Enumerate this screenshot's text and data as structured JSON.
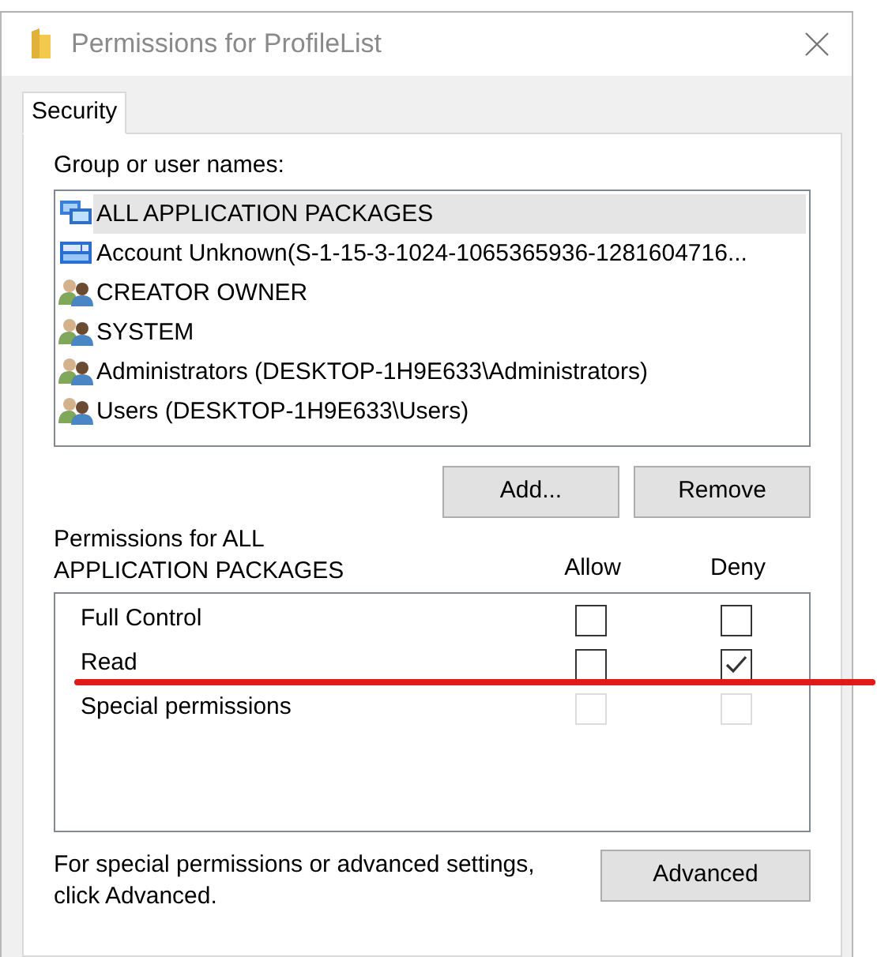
{
  "window": {
    "title": "Permissions for ProfileList"
  },
  "tabs": [
    {
      "label": "Security",
      "selected": true
    }
  ],
  "group_label": "Group or user names:",
  "principals": [
    {
      "name": "ALL APPLICATION PACKAGES",
      "kind": "package",
      "selected": true
    },
    {
      "name": "Account Unknown(S-1-15-3-1024-1065365936-1281604716...",
      "kind": "account",
      "selected": false
    },
    {
      "name": "CREATOR OWNER",
      "kind": "users",
      "selected": false
    },
    {
      "name": "SYSTEM",
      "kind": "users",
      "selected": false
    },
    {
      "name": "Administrators (DESKTOP-1H9E633\\Administrators)",
      "kind": "users",
      "selected": false
    },
    {
      "name": "Users (DESKTOP-1H9E633\\Users)",
      "kind": "users",
      "selected": false
    }
  ],
  "principal_buttons": [
    "Add...",
    "Remove"
  ],
  "permissions_label": "Permissions for ALL APPLICATION PACKAGES",
  "columns": [
    "Allow",
    "Deny"
  ],
  "permissions": [
    {
      "name": "Full Control",
      "allow": false,
      "deny": false,
      "disabled": false
    },
    {
      "name": "Read",
      "allow": false,
      "deny": true,
      "disabled": false
    },
    {
      "name": "Special permissions",
      "allow": false,
      "deny": false,
      "disabled": true
    }
  ],
  "advanced_note": "For special permissions or advanced settings, click Advanced.",
  "advanced_button": "Advanced"
}
